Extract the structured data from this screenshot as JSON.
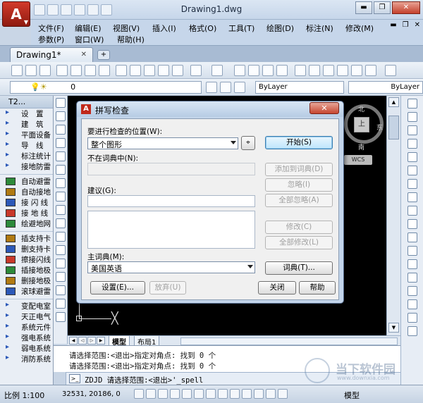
{
  "titlebar": {
    "title": "Drawing1.dwg",
    "minimize": "▬",
    "restore": "❐",
    "close": "✕"
  },
  "menubar": {
    "items": [
      "文件(F)",
      "编辑(E)",
      "视图(V)",
      "插入(I)",
      "格式(O)",
      "工具(T)",
      "绘图(D)",
      "标注(N)",
      "修改(M)",
      "参数(P)",
      "窗口(W)",
      "帮助(H)"
    ]
  },
  "tabs": {
    "doc_tab": "Drawing1*",
    "close_glyph": "✕",
    "new_tab_glyph": "+"
  },
  "layerbar": {
    "layer_value": "0",
    "color_value": "ByLayer",
    "linetype_value": "ByLayer"
  },
  "leftpanel": {
    "title": "T2...",
    "items": [
      "设　置",
      "建　筑",
      "平面设备",
      "导　线",
      "标注统计",
      "接地防雷",
      "自动避雷",
      "自动接地",
      "接 闪 线",
      "接 地 线",
      "绘避地网",
      "插支持卡",
      "删支持卡",
      "擦接闪线",
      "插接地极",
      "删接地极",
      "滚球避雷",
      "变配电室",
      "天正电气",
      "系统元件",
      "强电系统",
      "弱电系统",
      "消防系统"
    ]
  },
  "canvas": {
    "viewcube": {
      "top": "上",
      "north": "北",
      "south": "南",
      "east": "东",
      "west": "西"
    },
    "wcs_label": "WCS",
    "ucs_cross": "╳"
  },
  "layout_tabs": {
    "model": "模型",
    "layout1": "布局1"
  },
  "dialog": {
    "title": "拼写检查",
    "close_glyph": "✕",
    "where_label": "要进行检查的位置(W):",
    "where_value": "整个图形",
    "not_in_dict_label": "不在词典中(N):",
    "not_in_dict_value": "",
    "suggestion_label": "建议(G):",
    "suggestion_value": "",
    "main_dict_label": "主词典(M):",
    "main_dict_value": "美国英语",
    "buttons": {
      "start": "开始(S)",
      "add_to_dict": "添加到词典(D)",
      "ignore": "忽略(I)",
      "ignore_all": "全部忽略(A)",
      "change": "修改(C)",
      "change_all": "全部修改(L)",
      "dictionaries": "词典(T)...",
      "settings": "设置(E)...",
      "undo": "放弃(U)",
      "close": "关闭",
      "help": "帮助"
    }
  },
  "command": {
    "history": [
      "请选择范围:<退出>指定对角点: 找到 0 个",
      "请选择范围:<退出>指定对角点: 找到 0 个"
    ],
    "input": "ZDJD 请选择范围:<退出>'_spell",
    "prompt_glyph": ">_"
  },
  "statusbar": {
    "scale": "比例 1:100",
    "coords": "32531, 20186, 0",
    "model": "模型"
  },
  "watermark": {
    "text": "当下软件园",
    "sub": "www.downxia.com"
  }
}
